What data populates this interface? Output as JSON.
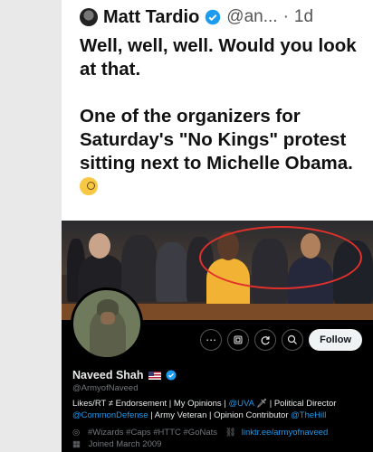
{
  "tweet": {
    "name": "Matt Tardio",
    "handle": "@an...",
    "separator": "·",
    "time": "1d",
    "paragraph1": "Well, well, well. Would you look at that.",
    "paragraph2": "One of the organizers for Saturday's \"No Kings\" protest sitting next to Michelle Obama."
  },
  "profile": {
    "follow_label": "Follow",
    "more_icon": "more-icon",
    "name": "Naveed Shah",
    "handle": "@ArmyofNaveed",
    "bio_line1_a": "Likes/RT ≠ Endorsement | My Opinions | ",
    "bio_line1_link": "@UVA",
    "bio_line1_b": " | Political Director",
    "bio_line2_link1": "@CommonDefense",
    "bio_line2_a": " | Army Veteran | Opinion Contributor ",
    "bio_line2_link2": "@TheHill",
    "location": "#Wizards #Caps #HTTC #GoNats",
    "website": "linktr.ee/armyofnaveed",
    "joined": "Joined March 2009"
  },
  "colors": {
    "verified": "#1d9bf0",
    "annotation": "#e2312b",
    "link": "#1d9bf0"
  }
}
